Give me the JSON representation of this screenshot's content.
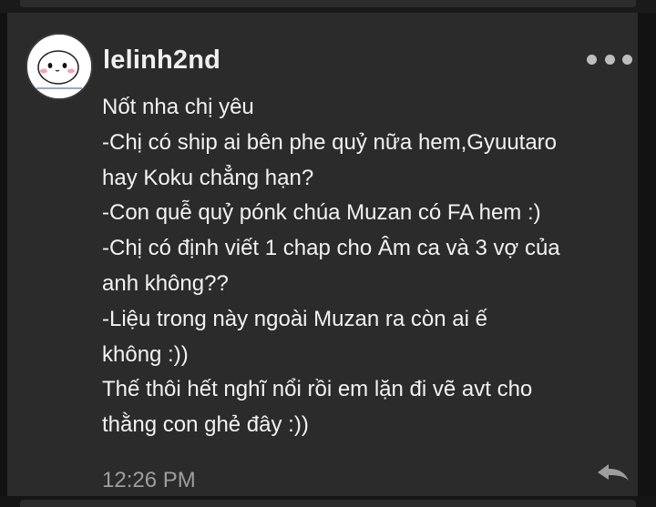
{
  "comment": {
    "author": "lelinh2nd",
    "avatar_icon": "cartoon-blob-avatar",
    "lines": [
      "Nốt nha chị yêu",
      "-Chị có ship ai bên phe quỷ nữa hem,Gyuutaro",
      "hay Koku chẳng hạn?",
      "-Con quễ quỷ pónk chúa Muzan có FA hem :)",
      "-Chị có định viết 1 chap cho Âm ca và 3 vợ của",
      "anh không??",
      "-Liệu trong này ngoài Muzan ra còn ai ế",
      "không :))",
      "Thế thôi hết nghĩ nổi rồi em lặn đi vẽ avt cho",
      "thằng con ghẻ đây :))"
    ],
    "timestamp": "12:26 PM",
    "more_icon": "more-dots-icon",
    "reply_icon": "reply-arrow-icon"
  },
  "colors": {
    "background": "#121212",
    "card": "#2b2b2b",
    "text": "#f2f2f2",
    "muted": "#9e9e9e"
  }
}
